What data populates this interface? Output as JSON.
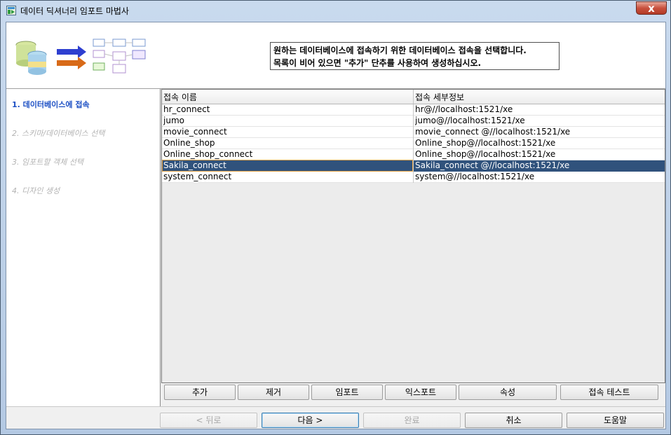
{
  "window": {
    "title": "데이터 딕셔너리 임포트 마법사",
    "close_label": "x"
  },
  "header": {
    "line1": "원하는 데이터베이스에 접속하기 위한 데이터베이스 접속을 선택합니다.",
    "line2": "목록이 비어 있으면 \"추가\" 단추를 사용하여 생성하십시오."
  },
  "steps": [
    {
      "label": "1. 데이터베이스에 접속",
      "active": true
    },
    {
      "label": "2. 스키마/데이터베이스 선택",
      "active": false
    },
    {
      "label": "3. 임포트할 객체 선택",
      "active": false
    },
    {
      "label": "4. 디자인 생성",
      "active": false
    }
  ],
  "table": {
    "columns": [
      "접속 이름",
      "접속 세부정보"
    ],
    "rows": [
      {
        "name": "hr_connect",
        "detail": "hr@//localhost:1521/xe",
        "selected": false
      },
      {
        "name": "jumo",
        "detail": "jumo@//localhost:1521/xe",
        "selected": false
      },
      {
        "name": "movie_connect",
        "detail": "movie_connect @//localhost:1521/xe",
        "selected": false
      },
      {
        "name": "Online_shop",
        "detail": "Online_shop@//localhost:1521/xe",
        "selected": false
      },
      {
        "name": "Online_shop_connect",
        "detail": "Online_shop@//localhost:1521/xe",
        "selected": false
      },
      {
        "name": "Sakila_connect",
        "detail": "Sakila_connect @//localhost:1521/xe",
        "selected": true
      },
      {
        "name": "system_connect",
        "detail": "system@//localhost:1521/xe",
        "selected": false
      }
    ]
  },
  "actions": {
    "add": "추가",
    "remove": "제거",
    "import": "임포트",
    "export": "익스포트",
    "properties": "속성",
    "test": "접속 테스트"
  },
  "nav": {
    "back": "< 뒤로",
    "next": "다음 >",
    "finish": "완료",
    "cancel": "취소",
    "help": "도움말"
  },
  "colors": {
    "selected_row": "#30527c",
    "active_step": "#1c4fc4",
    "close_button": "#c9513e"
  }
}
